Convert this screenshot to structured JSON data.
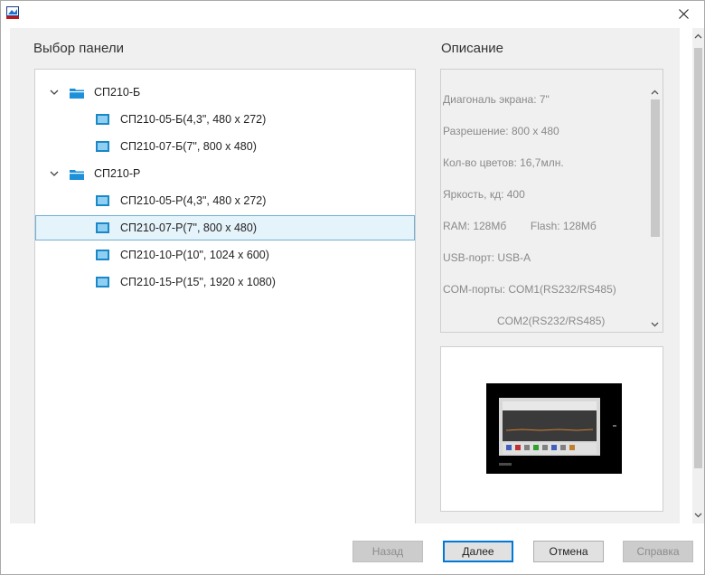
{
  "panel_select": {
    "title": "Выбор панели",
    "tree": [
      {
        "label": "СП210-Б",
        "type": "folder",
        "expanded": true
      },
      {
        "label": "СП210-05-Б(4,3\", 480 x 272)",
        "type": "panel"
      },
      {
        "label": "СП210-07-Б(7\", 800 x 480)",
        "type": "panel"
      },
      {
        "label": "СП210-Р",
        "type": "folder",
        "expanded": true
      },
      {
        "label": "СП210-05-Р(4,3\", 480 x 272)",
        "type": "panel"
      },
      {
        "label": "СП210-07-Р(7\", 800 x 480)",
        "type": "panel",
        "selected": true
      },
      {
        "label": "СП210-10-Р(10\", 1024 x 600)",
        "type": "panel"
      },
      {
        "label": "СП210-15-Р(15\", 1920 x 1080)",
        "type": "panel"
      }
    ]
  },
  "description": {
    "title": "Описание",
    "lines": [
      "Диагональ экрана: 7\"",
      "Разрешение: 800 x 480",
      "Кол-во цветов: 16,7млн.",
      "Яркость, кд: 400",
      "RAM: 128Мб        Flash: 128Мб",
      "USB-порт: USB-A",
      "COM-порты: COM1(RS232/RS485)",
      "                  COM2(RS232/RS485)"
    ]
  },
  "buttons": {
    "back": "Назад",
    "next": "Далее",
    "cancel": "Отмена",
    "help": "Справка"
  },
  "colors": {
    "folder_icon": "#1e90d8",
    "panel_icon": "#1a87c8",
    "selection_bg": "#e5f3fb",
    "selection_border": "#6fb1d6",
    "default_button_border": "#0078d7"
  }
}
